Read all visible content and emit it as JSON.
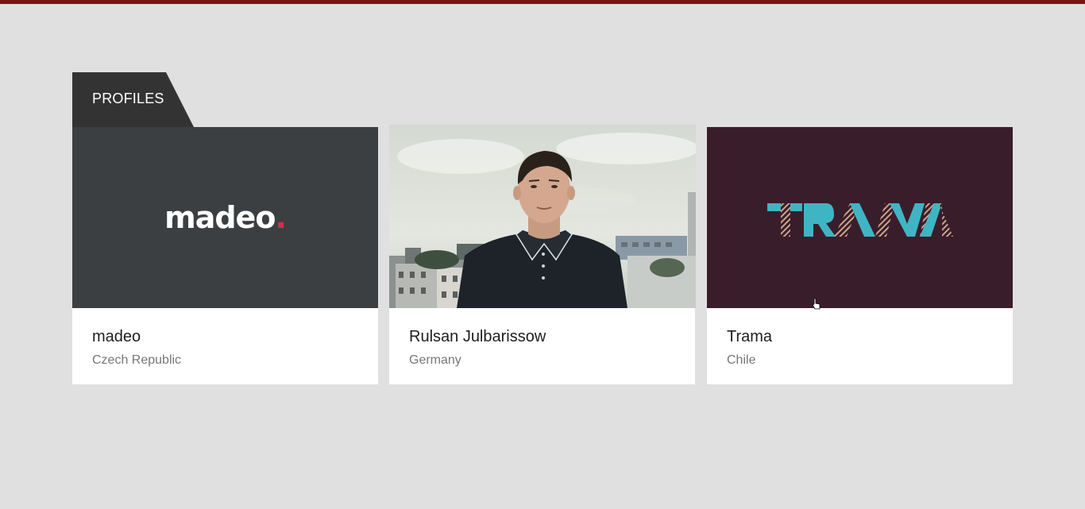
{
  "section": {
    "title": "PROFILES"
  },
  "colors": {
    "top_bar": "#7a1414",
    "background": "#e0e0e0",
    "tab": "#333333",
    "madeo_bg": "#3c3f42",
    "madeo_dot": "#e0284a",
    "trama_bg": "#3a1d2b",
    "trama_teal": "#3fb5c4",
    "trama_stripe": "#c9a48a"
  },
  "profiles": [
    {
      "name": "madeo",
      "country": "Czech Republic",
      "logo_text": "madeo",
      "logo_dot": "."
    },
    {
      "name": "Rulsan Julbarissow",
      "country": "Germany",
      "image": "portrait-photo"
    },
    {
      "name": "Trama",
      "country": "Chile",
      "logo_text": "TRAMA"
    }
  ]
}
